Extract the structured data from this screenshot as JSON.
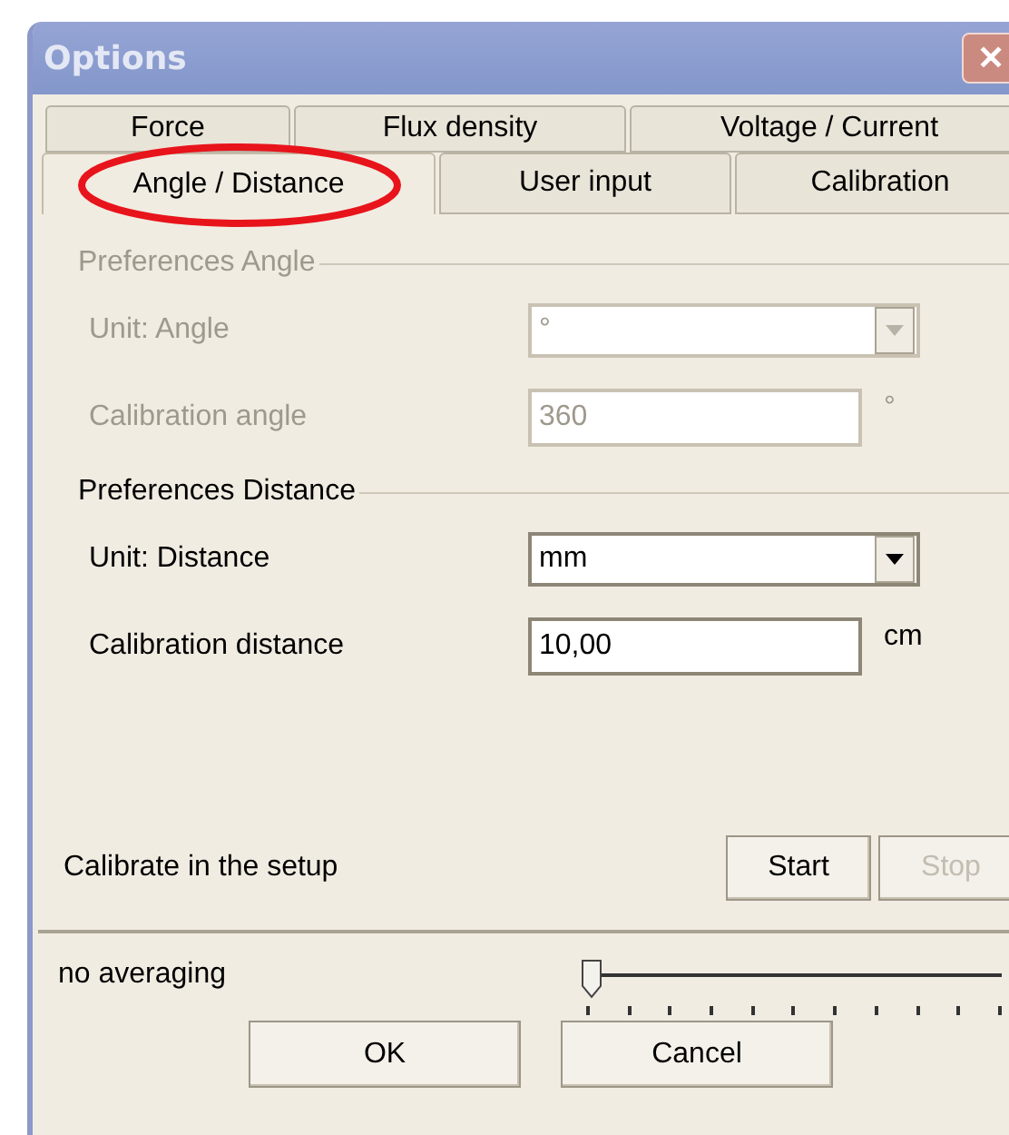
{
  "window": {
    "title": "Options",
    "close": "✕"
  },
  "tab_rows": [
    [
      {
        "label": "Force",
        "selected": false,
        "circled": false
      },
      {
        "label": "Flux density",
        "selected": false,
        "circled": false
      },
      {
        "label": "Voltage / Current",
        "selected": false,
        "circled": false
      }
    ],
    [
      {
        "label": "Angle / Distance",
        "selected": true,
        "circled": true
      },
      {
        "label": "User input",
        "selected": false,
        "circled": false
      },
      {
        "label": "Calibration",
        "selected": false,
        "circled": false
      }
    ]
  ],
  "sections": [
    {
      "title": "Preferences Angle",
      "disabled": true,
      "fields": [
        {
          "label": "Unit: Angle",
          "kind": "dropdown",
          "value": "°"
        },
        {
          "label": "Calibration angle",
          "kind": "text",
          "value": "360",
          "unit": "°"
        }
      ]
    },
    {
      "title": "Preferences Distance",
      "disabled": false,
      "fields": [
        {
          "label": "Unit: Distance",
          "kind": "dropdown",
          "value": "mm"
        },
        {
          "label": "Calibration distance",
          "kind": "text",
          "value": "10,00",
          "unit": "cm"
        }
      ]
    }
  ],
  "calibrate": {
    "label": "Calibrate in the setup",
    "buttons": [
      {
        "label": "Start",
        "disabled": false
      },
      {
        "label": "Stop",
        "disabled": true
      }
    ]
  },
  "averaging": {
    "label": "no averaging",
    "level": 0
  },
  "buttons": [
    "OK",
    "Cancel"
  ]
}
